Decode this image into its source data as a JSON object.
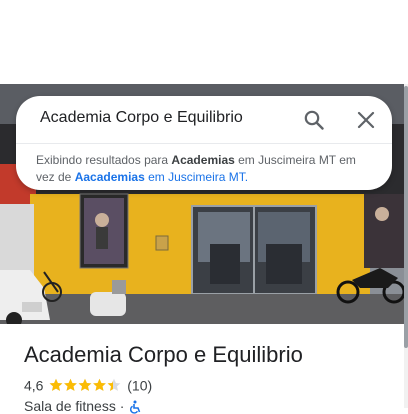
{
  "search": {
    "query": "Academia Corpo e Equilibrio",
    "search_label": "search-icon",
    "close_label": "close-icon"
  },
  "suggestion": {
    "prefix": "Exibindo resultados para ",
    "showing_term": "Academias",
    "middle": " em Juscimeira MT em vez de ",
    "original_term": "Aacademias",
    "suffix": " em Juscimeira MT."
  },
  "place": {
    "name": "Academia Corpo e Equilibrio",
    "rating": "4,6",
    "stars": 4.6,
    "review_count": "(10)",
    "category": "Sala de fitness",
    "separator": "·",
    "accessibility_icon": "wheelchair-icon"
  },
  "colors": {
    "link": "#1a73e8",
    "star": "#fbbc04",
    "wall": "#e8b21e"
  }
}
